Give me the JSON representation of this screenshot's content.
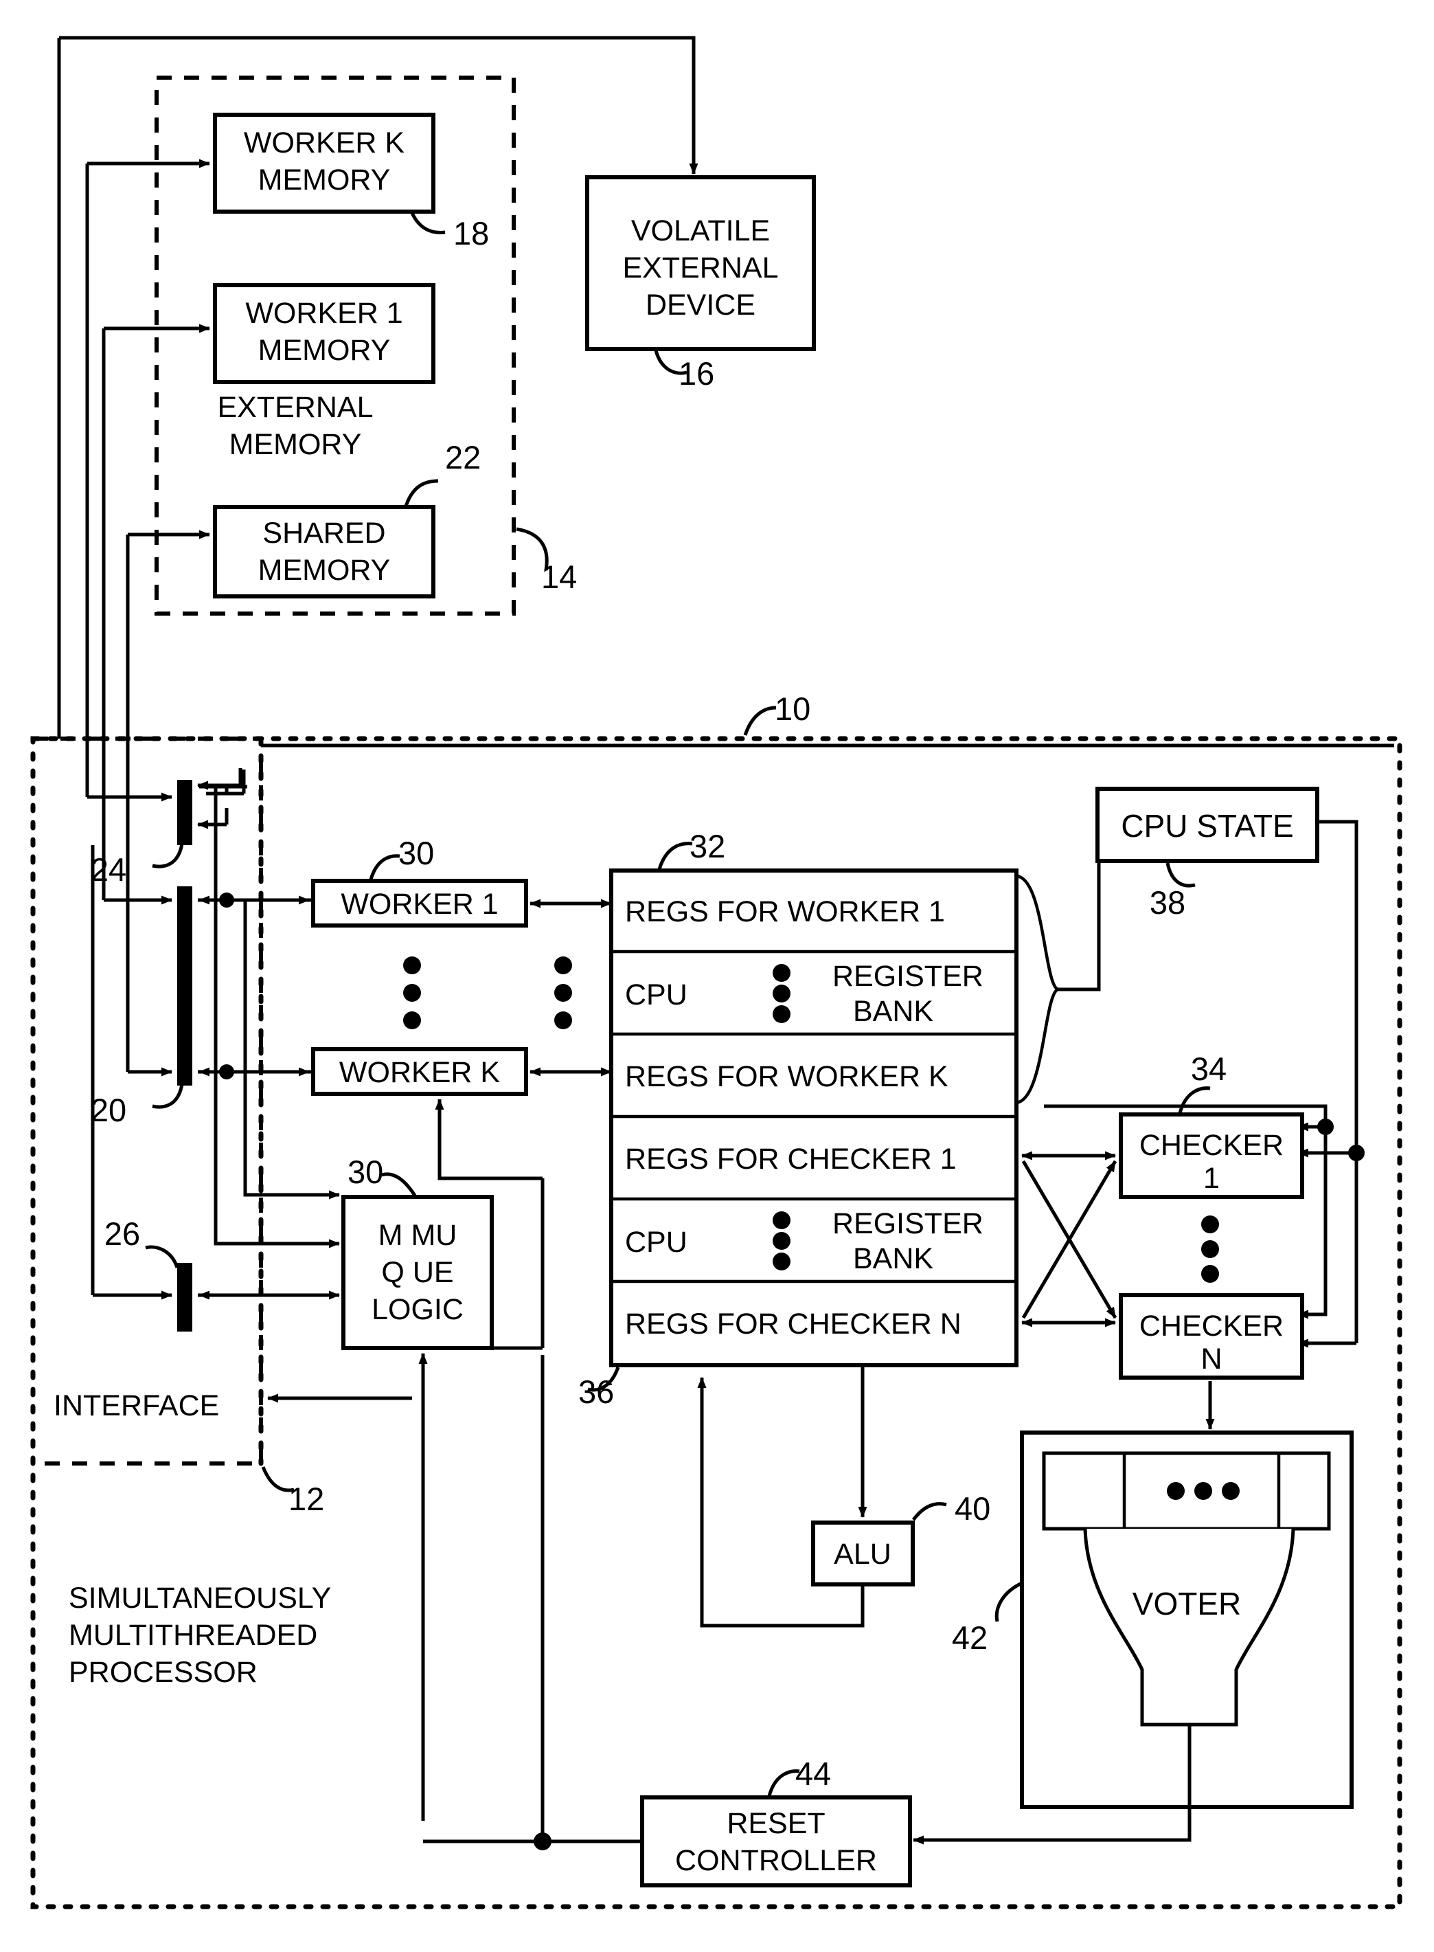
{
  "figure": {
    "title": "Simultaneously Multithreaded Processor Block Diagram",
    "type": "patent-block-diagram"
  },
  "external_memory_group": {
    "label_line1": "EXTERNAL",
    "label_line2": "MEMORY",
    "ref": "14",
    "boxes": [
      {
        "line1": "WORKER K",
        "line2": "MEMORY",
        "ref": "18"
      },
      {
        "line1": "WORKER 1",
        "line2": "MEMORY",
        "ref": ""
      },
      {
        "line1": "SHARED",
        "line2": "MEMORY",
        "ref": "22"
      }
    ]
  },
  "volatile_device": {
    "line1": "VOLATILE",
    "line2": "EXTERNAL",
    "line3": "DEVICE",
    "ref": "16"
  },
  "processor": {
    "label_line1": "SIMULTANEOUSLY",
    "label_line2": "MULTITHREADED",
    "label_line3": "PROCESSOR",
    "ref": "10"
  },
  "interface": {
    "label": "INTERFACE",
    "ref": "12",
    "bus_refs": [
      "24",
      "20",
      "26"
    ]
  },
  "workers": [
    {
      "label": "WORKER 1",
      "ref": "30"
    },
    {
      "label": "WORKER K",
      "ref": ""
    }
  ],
  "mmu": {
    "line1": "M MU",
    "line2": "Q UE",
    "line3": "LOGIC",
    "ref": "30"
  },
  "register_bank": {
    "ref": "32",
    "ref_lower": "36",
    "rows": [
      {
        "text": "REGS FOR WORKER 1",
        "kind": "regs"
      },
      {
        "left": "CPU",
        "right_line1": "REGISTER",
        "right_line2": "BANK",
        "kind": "cpu"
      },
      {
        "text": "REGS FOR WORKER K",
        "kind": "regs"
      },
      {
        "text": "REGS FOR CHECKER 1",
        "kind": "regs"
      },
      {
        "left": "CPU",
        "right_line1": "REGISTER",
        "right_line2": "BANK",
        "kind": "cpu"
      },
      {
        "text": "REGS FOR CHECKER N",
        "kind": "regs"
      }
    ]
  },
  "cpu_state": {
    "label": "CPU STATE",
    "ref": "38"
  },
  "checkers": [
    {
      "line1": "CHECKER",
      "line2": "1",
      "ref": "34"
    },
    {
      "line1": "CHECKER",
      "line2": "N",
      "ref": ""
    }
  ],
  "alu": {
    "label": "ALU",
    "ref": "40"
  },
  "voter": {
    "label": "VOTER",
    "ref": "42"
  },
  "reset_controller": {
    "line1": "RESET",
    "line2": "CONTROLLER",
    "ref": "44"
  },
  "colors": {
    "line": "#000000",
    "fill": "#ffffff"
  }
}
